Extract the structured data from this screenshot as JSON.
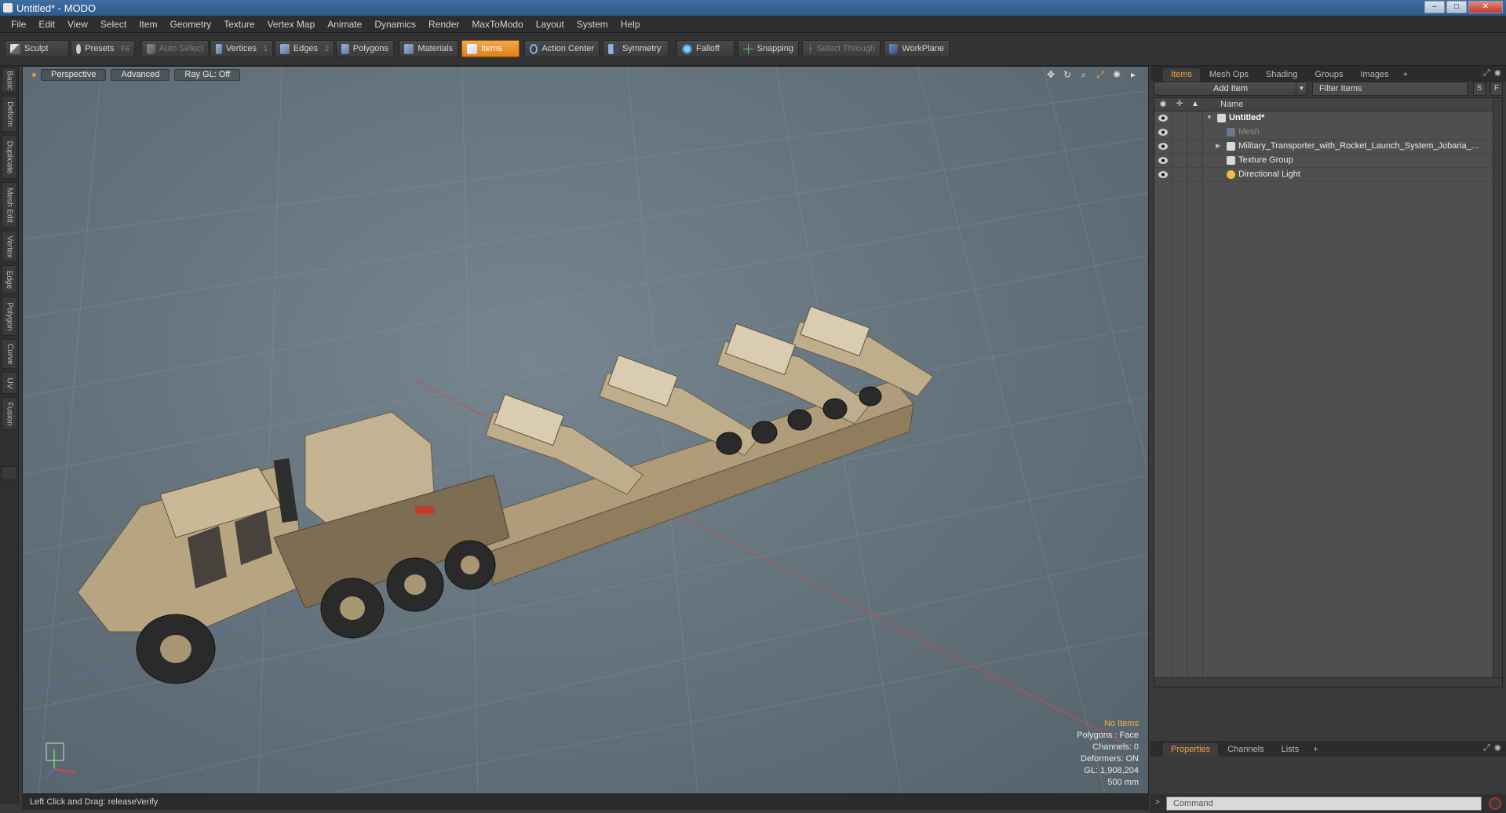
{
  "window": {
    "title": "Untitled* - MODO",
    "min": "–",
    "max": "□",
    "close": "✕"
  },
  "menu": [
    "File",
    "Edit",
    "View",
    "Select",
    "Item",
    "Geometry",
    "Texture",
    "Vertex Map",
    "Animate",
    "Dynamics",
    "Render",
    "MaxToModo",
    "Layout",
    "System",
    "Help"
  ],
  "toolbar": {
    "sculpt": "Sculpt",
    "presets": "Presets",
    "presets_key": "F6",
    "auto_select": "Auto Select",
    "vertices": "Vertices",
    "vertices_key": "1",
    "edges": "Edges",
    "edges_key": "2",
    "polygons": "Polygons",
    "materials": "Materials",
    "items": "Items",
    "action_center": "Action Center",
    "symmetry": "Symmetry",
    "falloff": "Falloff",
    "snapping": "Snapping",
    "select_through": "Select Through",
    "workplane": "WorkPlane"
  },
  "left_tabs": [
    "Basic",
    "Deform",
    "Duplicate",
    "Mesh Edit",
    "Vertex",
    "Edge",
    "Polygon",
    "Curve",
    "UV",
    "Fusion"
  ],
  "viewport": {
    "view": "Perspective",
    "shading": "Advanced",
    "raygl": "Ray GL: Off",
    "info": {
      "selection": "No Items",
      "polygons": "Polygons : Face",
      "channels": "Channels: 0",
      "deformers": "Deformers: ON",
      "gl": "GL: 1,908,204",
      "scale": "500 mm"
    }
  },
  "status": {
    "text": "Left Click and Drag:  releaseVerify"
  },
  "items_panel": {
    "tabs": [
      "Items",
      "Mesh Ops",
      "Shading",
      "Groups",
      "Images"
    ],
    "add_item": "Add Item",
    "filter": "Filter Items",
    "btn_s": "S",
    "btn_f": "F",
    "column_name": "Name",
    "tree": [
      {
        "label": "Untitled*",
        "indent": 0,
        "expanded": true
      },
      {
        "label": "Mesh",
        "indent": 1
      },
      {
        "label": "Military_Transporter_with_Rocket_Launch_System_Jobaria_...",
        "indent": 1,
        "collapsed": true
      },
      {
        "label": "Texture Group",
        "indent": 1
      },
      {
        "label": "Directional Light",
        "indent": 1
      }
    ]
  },
  "props_panel": {
    "tabs": [
      "Properties",
      "Channels",
      "Lists"
    ]
  },
  "command": {
    "placeholder": "Command"
  },
  "colors": {
    "accent": "#f2a43a",
    "titlebar": "#3f6ea3",
    "viewport": "#6b7882"
  }
}
